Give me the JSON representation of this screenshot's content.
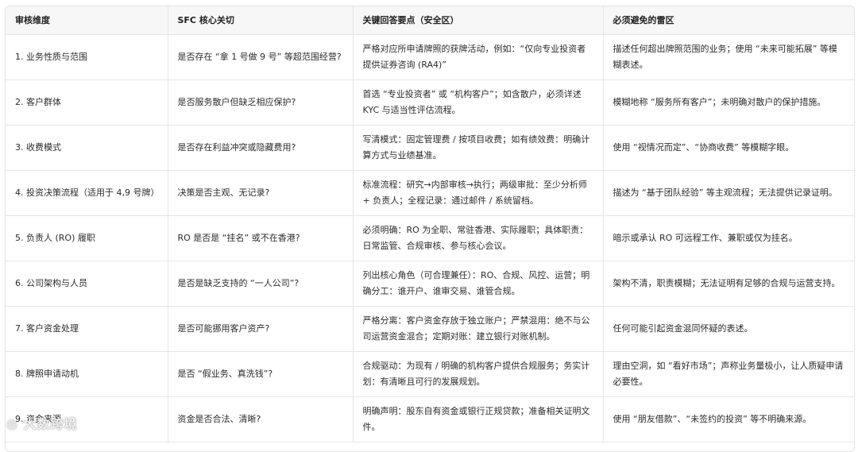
{
  "table": {
    "headers": [
      "审核维度",
      "SFC 核心关切",
      "关键回答要点（安全区）",
      "必须避免的雷区"
    ],
    "rows": [
      [
        "1. 业务性质与范围",
        "是否存在 “拿 1 号做 9 号” 等超范围经营?",
        "严格对应所申请牌照的获牌活动，例如：“仅向专业投资者提供证券咨询 (RA4)”",
        "描述任何超出牌照范围的业务；使用 “未来可能拓展” 等模糊表述。"
      ],
      [
        "2. 客户群体",
        "是否服务散户但缺乏相应保护?",
        "首选 “专业投资者” 或 “机构客户”；如含散户，必须详述 KYC 与适当性评估流程。",
        "模糊地称 “服务所有客户”；未明确对散户的保护措施。"
      ],
      [
        "3. 收费模式",
        "是否存在利益冲突或隐藏费用?",
        "写清模式：固定管理费 / 按项目收费；如有绩效费：明确计算方式与业绩基准。",
        "使用 “视情况而定”、“协商收费” 等模糊字眼。"
      ],
      [
        "4. 投资决策流程（适用于 4,9 号牌）",
        "决策是否主观、无记录?",
        "标准流程：研究→内部审核→执行；两级审批：至少分析师 + 负责人；全程记录：通过邮件 / 系统留档。",
        "描述为 “基于团队经验” 等主观流程；无法提供记录证明。"
      ],
      [
        "5. 负责人 (RO) 履职",
        "RO 是否是 “挂名” 或不在香港?",
        "必须明确：RO 为全职、常驻香港、实际履职；具体职责：日常监管、合规审核、参与核心会议。",
        "暗示或承认 RO 可远程工作、兼职或仅为挂名。"
      ],
      [
        "6. 公司架构与人员",
        "是否是缺乏支持的 “一人公司”?",
        "列出核心角色（可合理兼任）：RO、合规、风控、运营；明确分工：谁开户、谁审交易、谁管合规。",
        "架构不清，职责模糊；无法证明有足够的合规与运营支持。"
      ],
      [
        "7. 客户资金处理",
        "是否可能挪用客户资产?",
        "严格分离：客户资金存放于独立账户；严禁混用：绝不与公司运营资金混合；定期对账：建立银行对账机制。",
        "任何可能引起资金混同怀疑的表述。"
      ],
      [
        "8. 牌照申请动机",
        "是否 “假业务、真洗钱”?",
        "合规驱动：为现有 / 明确的机构客户提供合规服务；务实计划：有清晰且可行的发展规划。",
        "理由空洞，如 “看好市场”；声称业务量极小，让人质疑申请必要性。"
      ],
      [
        "9. 资金来源",
        "资金是否合法、清晰?",
        "明确声明：股东自有资金或银行正规贷款；准备相关证明文件。",
        "使用 “朋友借款”、“未签约的投资” 等不明确来源。"
      ]
    ]
  },
  "watermark": "◎ 大数跨境"
}
